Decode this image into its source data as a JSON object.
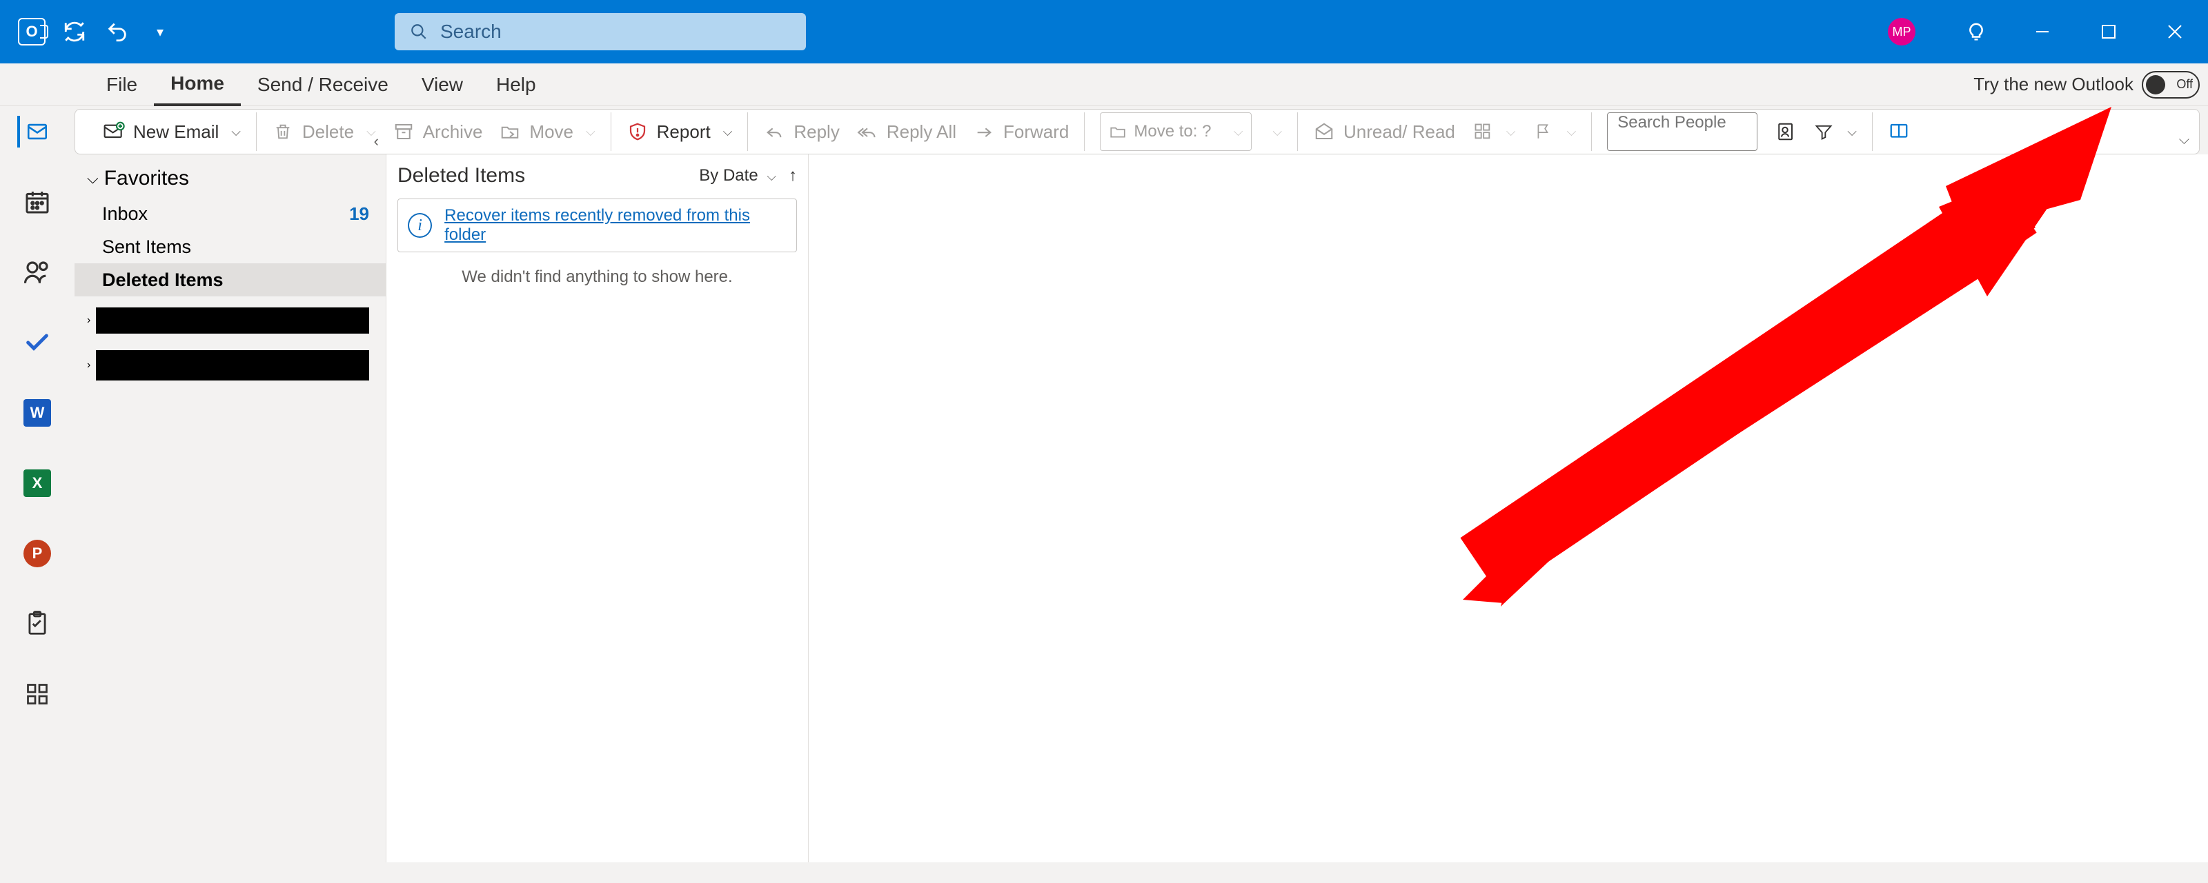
{
  "titlebar": {
    "search_placeholder": "Search",
    "avatar_initials": "MP"
  },
  "menu": {
    "tabs": [
      "File",
      "Home",
      "Send / Receive",
      "View",
      "Help"
    ],
    "active_index": 1,
    "try_new_label": "Try the new Outlook",
    "toggle_state": "Off"
  },
  "ribbon": {
    "new_email": "New Email",
    "delete": "Delete",
    "archive": "Archive",
    "move": "Move",
    "report": "Report",
    "reply": "Reply",
    "reply_all": "Reply All",
    "forward": "Forward",
    "move_to_placeholder": "Move to: ?",
    "unread_read": "Unread/ Read",
    "search_people_placeholder": "Search People"
  },
  "folders": {
    "favorites_label": "Favorites",
    "items": [
      {
        "name": "Inbox",
        "count": "19"
      },
      {
        "name": "Sent Items",
        "count": ""
      },
      {
        "name": "Deleted Items",
        "count": ""
      }
    ],
    "selected_index": 2
  },
  "message_list": {
    "title": "Deleted Items",
    "sort_label": "By Date",
    "recover_link": "Recover items recently removed from this folder",
    "empty_text": "We didn't find anything to show here."
  },
  "annotation": {
    "type": "arrow",
    "color": "#ff0000",
    "purpose": "Points to Try-the-new-Outlook toggle"
  }
}
